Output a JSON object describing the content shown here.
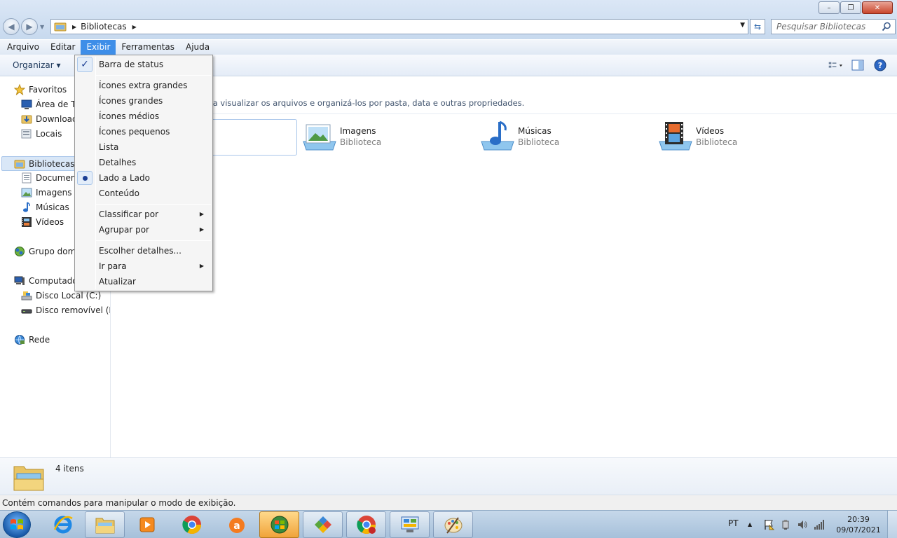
{
  "window": {
    "address_path": "Bibliotecas",
    "search_placeholder": "Pesquisar Bibliotecas",
    "controls": {
      "minimize": "–",
      "maximize": "❐",
      "close": "✕"
    }
  },
  "menubar": [
    "Arquivo",
    "Editar",
    "Exibir",
    "Ferramentas",
    "Ajuda"
  ],
  "toolbar": {
    "organize_label": "Organizar ▾"
  },
  "navpane": {
    "favorites": {
      "label": "Favoritos",
      "items": [
        "Área de Tr",
        "Download",
        "Locais"
      ]
    },
    "libraries": {
      "label": "Bibliotecas",
      "items": [
        "Document",
        "Imagens",
        "Músicas",
        "Vídeos"
      ]
    },
    "homegroup": "Grupo domé",
    "computer": {
      "label": "Computado",
      "items": [
        "Disco Local (C:)",
        "Disco removível (F:)"
      ]
    },
    "network": "Rede"
  },
  "content": {
    "description": "ra visualizar os arquivos e organizá-los por pasta, data e outras propriedades.",
    "libraries": [
      {
        "name": "Imagens",
        "type": "Biblioteca",
        "icon": "images-library-icon"
      },
      {
        "name": "Músicas",
        "type": "Biblioteca",
        "icon": "music-library-icon"
      },
      {
        "name": "Vídeos",
        "type": "Biblioteca",
        "icon": "videos-library-icon"
      }
    ]
  },
  "popup_menu": {
    "status_bar": "Barra de status",
    "views": [
      "Ícones extra grandes",
      "Ícones grandes",
      "Ícones médios",
      "Ícones pequenos",
      "Lista",
      "Detalhes",
      "Lado a Lado",
      "Conteúdo"
    ],
    "sort_by": "Classificar por",
    "group_by": "Agrupar por",
    "choose_details": "Escolher detalhes...",
    "go_to": "Ir para",
    "refresh": "Atualizar",
    "selected_view": "Lado a Lado"
  },
  "details_pane": {
    "count": "4 itens"
  },
  "statusbar": {
    "text": "Contém comandos para manipular o modo de exibição."
  },
  "taskbar": {
    "language": "PT",
    "time": "20:39",
    "date": "09/07/2021"
  },
  "colors": {
    "menu_highlight": "#3e8ee8",
    "selection": "#d9e7f7"
  }
}
